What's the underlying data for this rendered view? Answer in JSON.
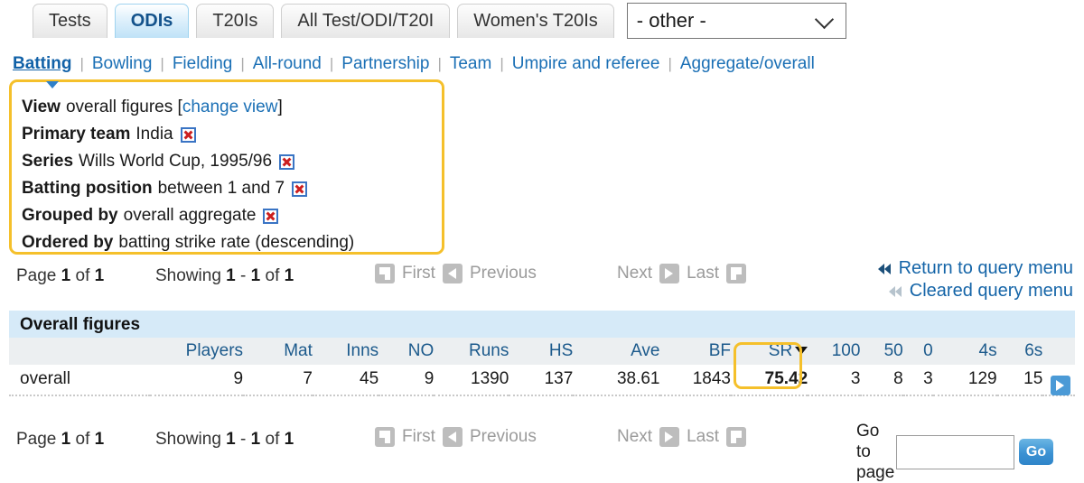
{
  "tabs": [
    {
      "label": "Tests",
      "active": false
    },
    {
      "label": "ODIs",
      "active": true
    },
    {
      "label": "T20Is",
      "active": false
    },
    {
      "label": "All Test/ODI/T20I",
      "active": false
    },
    {
      "label": "Women's T20Is",
      "active": false
    }
  ],
  "format_select": {
    "value": "- other -",
    "icon": "chevron-down-icon"
  },
  "subnav": [
    {
      "label": "Batting",
      "current": true
    },
    {
      "label": "Bowling",
      "current": false
    },
    {
      "label": "Fielding",
      "current": false
    },
    {
      "label": "All-round",
      "current": false
    },
    {
      "label": "Partnership",
      "current": false
    },
    {
      "label": "Team",
      "current": false
    },
    {
      "label": "Umpire and referee",
      "current": false
    },
    {
      "label": "Aggregate/overall",
      "current": false
    }
  ],
  "query_box": {
    "highlight_color": "#f5c02b",
    "lines": [
      {
        "key": "View",
        "value": "overall figures",
        "link": "change view",
        "bracketed": true,
        "removable": false
      },
      {
        "key": "Primary team",
        "value": "India",
        "removable": true
      },
      {
        "key": "Series",
        "value": "Wills World Cup, 1995/96",
        "removable": true
      },
      {
        "key": "Batting position",
        "value": "between 1 and 7",
        "removable": true
      },
      {
        "key": "Grouped by",
        "value": "overall aggregate",
        "removable": true
      },
      {
        "key": "Ordered by",
        "value": "batting strike rate (descending)",
        "removable": false
      }
    ]
  },
  "pagination": {
    "page_prefix": "Page",
    "page_current": "1",
    "page_of": "of",
    "page_total": "1",
    "showing_prefix": "Showing",
    "showing_from": "1",
    "showing_dash": "-",
    "showing_to": "1",
    "showing_of": "of",
    "showing_total": "1",
    "first": "First",
    "previous": "Previous",
    "next": "Next",
    "last": "Last"
  },
  "query_menu": {
    "return_label": "Return to query menu",
    "cleared_label": "Cleared query menu"
  },
  "results": {
    "title": "Overall figures",
    "sorted_column": "SR",
    "sort_direction": "descending",
    "columns": [
      "",
      "Players",
      "Mat",
      "Inns",
      "NO",
      "Runs",
      "HS",
      "Ave",
      "BF",
      "SR",
      "100",
      "50",
      "0",
      "4s",
      "6s"
    ],
    "rows": [
      {
        "label": "overall",
        "values": [
          "9",
          "7",
          "45",
          "9",
          "1390",
          "137",
          "38.61",
          "1843",
          "75.42",
          "3",
          "8",
          "3",
          "129",
          "15"
        ]
      }
    ]
  },
  "goto": {
    "label_line1": "Go to",
    "label_line2": "page",
    "input_value": "",
    "input_placeholder": "",
    "button_label": "Go"
  }
}
